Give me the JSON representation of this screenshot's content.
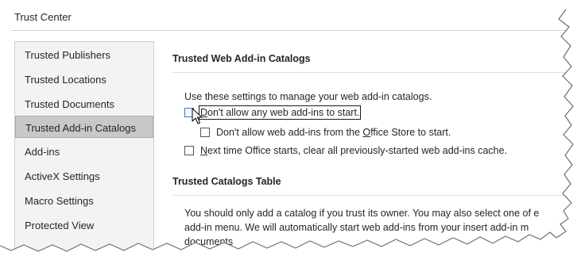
{
  "window": {
    "title": "Trust Center"
  },
  "sidebar": {
    "items": [
      {
        "label": "Trusted Publishers",
        "active": false
      },
      {
        "label": "Trusted Locations",
        "active": false
      },
      {
        "label": "Trusted Documents",
        "active": false
      },
      {
        "label": "Trusted Add-in Catalogs",
        "active": true
      },
      {
        "label": "Add-ins",
        "active": false
      },
      {
        "label": "ActiveX Settings",
        "active": false
      },
      {
        "label": "Macro Settings",
        "active": false
      },
      {
        "label": "Protected View",
        "active": false
      }
    ]
  },
  "web_catalogs": {
    "header": "Trusted Web Add-in Catalogs",
    "description": "Use these settings to manage your web add-in catalogs.",
    "option_no_addins": {
      "mnemonic": "D",
      "label_rest": "on't allow any web add-ins to start.",
      "checked": false
    },
    "option_no_store": {
      "label_before": "Don't allow web add-ins from the ",
      "mnemonic": "O",
      "label_after": "ffice Store to start.",
      "checked": false
    },
    "option_clear_cache": {
      "mnemonic": "N",
      "label_rest": "ext time Office starts, clear all previously-started web add-ins cache.",
      "checked": false
    }
  },
  "catalogs_table": {
    "header": "Trusted Catalogs Table",
    "paragraph_lines": [
      "You should only add a catalog if you trust its owner. You may also select one of e",
      "add-in menu. We will automatically start web add-ins from your insert add-in m",
      "documents"
    ]
  },
  "colors": {
    "sidebar_bg": "#f3f3f3",
    "active_item_bg": "#c8c8c8",
    "text": "#262626"
  },
  "icons": {
    "cursor": "mouse-pointer-icon"
  }
}
